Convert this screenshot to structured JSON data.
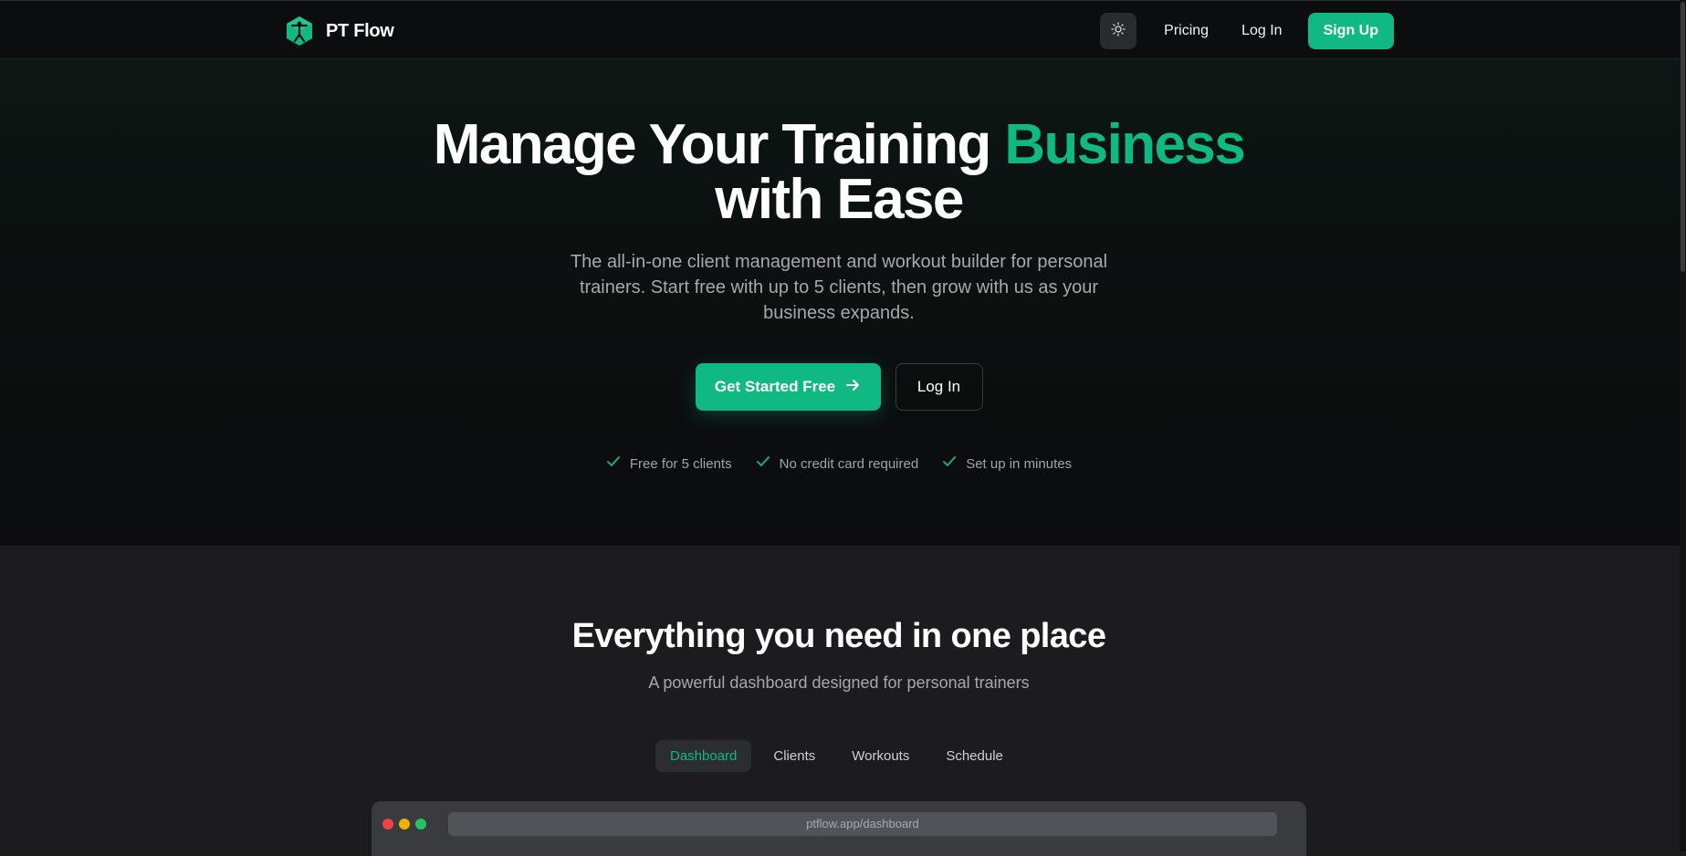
{
  "nav": {
    "brand": "PT Flow",
    "links": [
      {
        "label": "Pricing"
      },
      {
        "label": "Log In"
      }
    ],
    "signup_label": "Sign Up",
    "theme_icon": "sun-icon",
    "logo_icon": "logo-icon"
  },
  "hero": {
    "title_part1": "Manage Your Training ",
    "title_accent": "Business",
    "title_part2": "with Ease",
    "subtitle": "The all-in-one client management and workout builder for personal trainers. Start free with up to 5 clients, then grow with us as your business expands.",
    "cta_primary": "Get Started Free",
    "cta_primary_icon": "arrow-right-icon",
    "cta_secondary": "Log In",
    "checks": [
      {
        "label": "Free for 5 clients",
        "icon": "check-icon"
      },
      {
        "label": "No credit card required",
        "icon": "check-icon"
      },
      {
        "label": "Set up in minutes",
        "icon": "check-icon"
      }
    ]
  },
  "features": {
    "title": "Everything you need in one place",
    "subtitle": "A powerful dashboard designed for personal trainers",
    "tabs": [
      {
        "label": "Dashboard",
        "active": true
      },
      {
        "label": "Clients",
        "active": false
      },
      {
        "label": "Workouts",
        "active": false
      },
      {
        "label": "Schedule",
        "active": false
      }
    ],
    "browser_url": "ptflow.app/dashboard"
  },
  "colors": {
    "accent": "#10b981",
    "background": "#0c0d0e",
    "section": "#1c1c1e"
  }
}
